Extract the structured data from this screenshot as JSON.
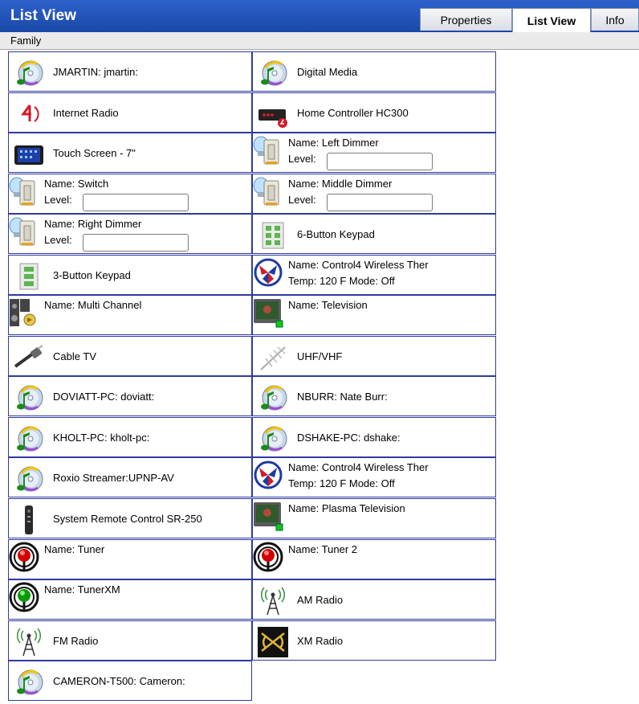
{
  "window": {
    "title": "List View"
  },
  "tabs": [
    "Properties",
    "List View",
    "Info"
  ],
  "family_label": "Family",
  "items": [
    {
      "type": "text",
      "icon": "cd-music-icon",
      "label": "JMARTIN: jmartin:"
    },
    {
      "type": "text",
      "icon": "cd-music-icon",
      "label": "Digital Media"
    },
    {
      "type": "text",
      "icon": "internet-radio-icon",
      "label": "Internet Radio"
    },
    {
      "type": "text",
      "icon": "home-controller-icon",
      "label": "Home Controller HC300"
    },
    {
      "type": "text",
      "icon": "touch-screen-icon",
      "label": "Touch Screen - 7\""
    },
    {
      "type": "dimmer",
      "icon": "light-switch-icon",
      "name_label": "Name:",
      "name": "Left Dimmer",
      "level_label": "Level:"
    },
    {
      "type": "dimmer",
      "icon": "light-switch-icon",
      "name_label": "Name:",
      "name": "Switch",
      "level_label": "Level:"
    },
    {
      "type": "dimmer",
      "icon": "light-switch-icon",
      "name_label": "Name:",
      "name": "Middle Dimmer",
      "level_label": "Level:"
    },
    {
      "type": "dimmer",
      "icon": "light-switch-icon",
      "name_label": "Name:",
      "name": "Right Dimmer",
      "level_label": "Level:"
    },
    {
      "type": "text",
      "icon": "keypad-6-icon",
      "label": "6-Button Keypad"
    },
    {
      "type": "text",
      "icon": "keypad-3-icon",
      "label": "3-Button Keypad"
    },
    {
      "type": "thermo",
      "icon": "thermostat-icon",
      "name_label": "Name:",
      "name": "Control4  Wireless Ther",
      "detail": "Temp:   120 F     Mode:  Off"
    },
    {
      "type": "name",
      "icon": "speakers-icon",
      "name_label": "Name:",
      "name": "Multi Channel"
    },
    {
      "type": "name",
      "icon": "television-icon",
      "name_label": "Name:",
      "name": "Television"
    },
    {
      "type": "text",
      "icon": "cable-icon",
      "label": "Cable TV"
    },
    {
      "type": "text",
      "icon": "antenna-icon",
      "label": "UHF/VHF"
    },
    {
      "type": "text",
      "icon": "cd-music-icon",
      "label": "DOVIATT-PC: doviatt:"
    },
    {
      "type": "text",
      "icon": "cd-music-icon",
      "label": "NBURR: Nate Burr:"
    },
    {
      "type": "text",
      "icon": "cd-music-icon",
      "label": "KHOLT-PC: kholt-pc:"
    },
    {
      "type": "text",
      "icon": "cd-music-icon",
      "label": "DSHAKE-PC: dshake:"
    },
    {
      "type": "text",
      "icon": "cd-music-icon",
      "label": "Roxio Streamer:UPNP-AV"
    },
    {
      "type": "thermo",
      "icon": "thermostat-icon",
      "name_label": "Name:",
      "name": "Control4  Wireless Ther",
      "detail": "Temp:   120 F     Mode:  Off"
    },
    {
      "type": "text",
      "icon": "remote-control-icon",
      "label": "System Remote Control SR-250"
    },
    {
      "type": "name",
      "icon": "television-icon",
      "name_label": "Name:",
      "name": "Plasma Television"
    },
    {
      "type": "name",
      "icon": "tuner-red-icon",
      "name_label": "Name:",
      "name": "Tuner"
    },
    {
      "type": "name",
      "icon": "tuner-red-icon",
      "name_label": "Name:",
      "name": "Tuner 2"
    },
    {
      "type": "name",
      "icon": "tuner-green-icon",
      "name_label": "Name:",
      "name": "TunerXM"
    },
    {
      "type": "text",
      "icon": "radio-tower-icon",
      "label": "AM Radio"
    },
    {
      "type": "text",
      "icon": "radio-tower-icon",
      "label": "FM Radio"
    },
    {
      "type": "text",
      "icon": "xm-radio-icon",
      "label": "XM Radio"
    },
    {
      "type": "text",
      "icon": "cd-music-icon",
      "label": "CAMERON-T500: Cameron:"
    }
  ]
}
